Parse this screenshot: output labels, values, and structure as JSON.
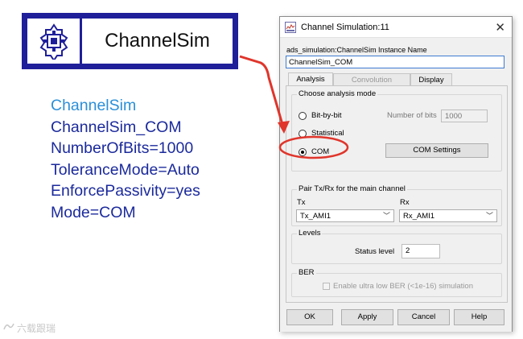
{
  "component": {
    "name": "ChannelSim",
    "icon": "gear-chip-icon"
  },
  "params": {
    "lines": [
      "ChannelSim",
      "ChannelSim_COM",
      "NumberOfBits=1000",
      "ToleranceMode=Auto",
      "EnforcePassivity=yes",
      "Mode=COM"
    ]
  },
  "watermark": {
    "text": "六载跟瑞",
    "icon": "logo-icon"
  },
  "dialog": {
    "title": "Channel Simulation:11",
    "app_icon": "ads-icon",
    "close_icon": "close-icon",
    "instance_label": "ads_simulation:ChannelSim Instance Name",
    "instance_value": "ChannelSim_COM",
    "tabs": {
      "analysis": "Analysis",
      "convolution": "Convolution",
      "display": "Display"
    },
    "analysis_mode": {
      "group_title": "Choose analysis mode",
      "options": {
        "bit_by_bit": "Bit-by-bit",
        "statistical": "Statistical",
        "com": "COM"
      },
      "selected": "COM",
      "number_of_bits_label": "Number of bits",
      "number_of_bits_value": "1000",
      "com_settings_button": "COM Settings"
    },
    "pair": {
      "group_title": "Pair Tx/Rx for the main channel",
      "tx_label": "Tx",
      "rx_label": "Rx",
      "tx_value": "Tx_AMI1",
      "rx_value": "Rx_AMI1"
    },
    "levels": {
      "group_title": "Levels",
      "status_label": "Status level",
      "status_value": "2"
    },
    "ber": {
      "group_title": "BER",
      "checkbox_label": "Enable ultra low BER (<1e-16) simulation"
    },
    "buttons": {
      "ok": "OK",
      "apply": "Apply",
      "cancel": "Cancel",
      "help": "Help"
    }
  },
  "colors": {
    "component_border": "#1f1f9a",
    "param_text": "#1b2a9c",
    "param_first": "#2a8fd8",
    "highlight_red": "#e0352b",
    "focus_blue": "#3d7bd1"
  }
}
